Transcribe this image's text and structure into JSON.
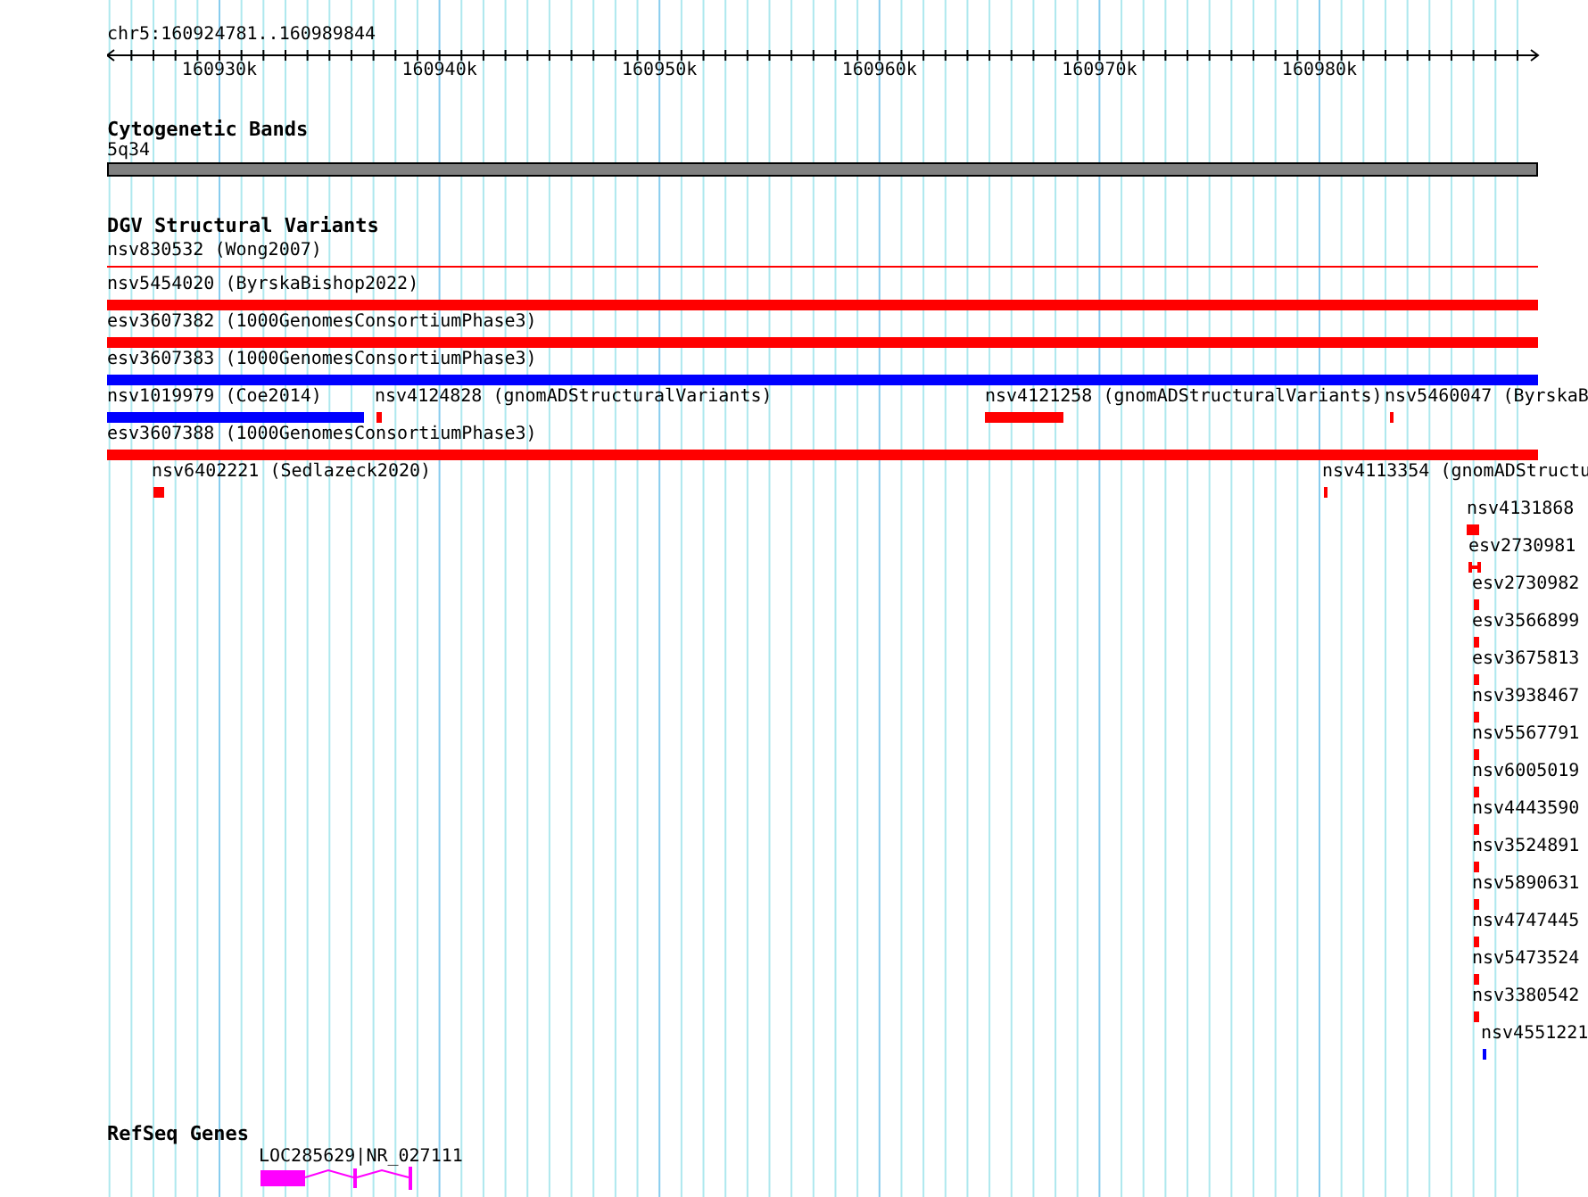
{
  "ruler": {
    "region": "chr5:160924781..160989844",
    "ticks": [
      "160930k",
      "160940k",
      "160950k",
      "160960k",
      "160970k",
      "160980k"
    ]
  },
  "tracks": [
    {
      "title": "Cytogenetic Bands",
      "kind": "bands",
      "features": [
        {
          "label": "5q34"
        }
      ]
    },
    {
      "title": "DGV Structural Variants",
      "kind": "variants",
      "features": [
        {
          "label": "nsv830532 (Wong2007)",
          "kind": "line",
          "color": "#ff0000"
        },
        {
          "label": "nsv5454020 (ByrskaBishop2022)",
          "kind": "bar",
          "color": "#ff0000"
        },
        {
          "label": "esv3607382 (1000GenomesConsortiumPhase3)",
          "kind": "bar",
          "color": "#ff0000"
        },
        {
          "label": "esv3607383 (1000GenomesConsortiumPhase3)",
          "kind": "bar",
          "color": "#0000ff"
        },
        {
          "label": "nsv1019979 (Coe2014)",
          "kind": "bar",
          "color": "#0000ff"
        },
        {
          "label": "nsv4124828 (gnomADStructuralVariants)",
          "kind": "bar",
          "color": "#ff0000"
        },
        {
          "label": "nsv4121258 (gnomADStructuralVariants)",
          "kind": "bar",
          "color": "#ff0000"
        },
        {
          "label": "nsv5460047 (ByrskaB",
          "kind": "bar",
          "color": "#ff0000"
        },
        {
          "label": "esv3607388 (1000GenomesConsortiumPhase3)",
          "kind": "bar",
          "color": "#ff0000"
        },
        {
          "label": "nsv6402221 (Sedlazeck2020)",
          "kind": "bar",
          "color": "#ff0000"
        },
        {
          "label": "nsv4113354 (gnomADStructu",
          "kind": "bar",
          "color": "#ff0000"
        },
        {
          "label": "nsv4131868",
          "kind": "bar",
          "color": "#ff0000"
        },
        {
          "label": "esv2730981",
          "kind": "split",
          "color": "#ff0000"
        },
        {
          "label": "esv2730982",
          "kind": "bar",
          "color": "#ff0000"
        },
        {
          "label": "esv3566899",
          "kind": "bar",
          "color": "#ff0000"
        },
        {
          "label": "esv3675813",
          "kind": "bar",
          "color": "#ff0000"
        },
        {
          "label": "nsv3938467",
          "kind": "bar",
          "color": "#ff0000"
        },
        {
          "label": "nsv5567791",
          "kind": "bar",
          "color": "#ff0000"
        },
        {
          "label": "nsv6005019",
          "kind": "bar",
          "color": "#ff0000"
        },
        {
          "label": "nsv4443590",
          "kind": "bar",
          "color": "#ff0000"
        },
        {
          "label": "nsv3524891",
          "kind": "bar",
          "color": "#ff0000"
        },
        {
          "label": "nsv5890631",
          "kind": "bar",
          "color": "#ff0000"
        },
        {
          "label": "nsv4747445",
          "kind": "bar",
          "color": "#ff0000"
        },
        {
          "label": "nsv5473524",
          "kind": "bar",
          "color": "#ff0000"
        },
        {
          "label": "nsv3380542",
          "kind": "bar",
          "color": "#ff0000"
        },
        {
          "label": "nsv4551221",
          "kind": "bar",
          "color": "#0000ff"
        }
      ]
    },
    {
      "title": "RefSeq Genes",
      "kind": "genes",
      "features": [
        {
          "label": "LOC285629|NR_027111"
        }
      ]
    }
  ]
}
